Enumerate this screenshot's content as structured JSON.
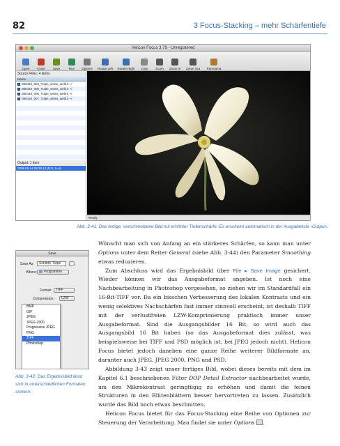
{
  "page": {
    "number": "82",
    "running_head": "3 Focus-Stacking – mehr Schärfentiefe"
  },
  "app": {
    "title": "Helicon Focus 3.79 - Unregistered",
    "toolbar": [
      "Open",
      "Close",
      "Save",
      "Run",
      "Options",
      "Rotate Left",
      "Rotate Right",
      "Copy",
      "Zoom",
      "Zoom in",
      "Zoom Out",
      "Panorama"
    ],
    "source_label": "Source Files: 4 items",
    "col_name": "Name",
    "files": [
      "080419_004_Tulpe_weiss_welk.ti ~/",
      "080419_005_Tulpe_weiss_welk.ti ~/",
      "080419_006_Tulpe_weiss_welk.ti ~/",
      "080419_007_Tulpe_weiss_welk.ti ~/"
    ],
    "output_label": "Output: 1 item",
    "output_row": "2008.05.14 09:25:13 (R:8, S=4)",
    "status": "Ready"
  },
  "caption1": "Abb. 3-41: Das fertige, verschmolzene Bild mit erhöhter Tiefenschärfe. Es erscheint automatisch in der Ausgabeliste ›Output‹.",
  "dialog": {
    "title": "Save",
    "save_as_label": "Save As:",
    "save_as_value": "Schärfe-Tulpe",
    "where_label": "Where:",
    "where_value": "Programme",
    "format_label": "Format:",
    "format_value": "TIFF",
    "compression_label": "Compression:",
    "compression_value": "LZW",
    "formats": [
      "BMP",
      "GIF",
      "JPEG",
      "JPEG-2000",
      "Progressive JPEG",
      "PNG",
      "TIFF",
      "Photoshop"
    ],
    "selected_format": "TIFF"
  },
  "caption2": "Abb. 3-42: Das Ergebnisbild lässt sich in unterschiedlichen Formaten sichern.",
  "body": {
    "p1": {
      "a": "Wünscht man sich von Anfang an ein stärkeres Schärfen, so kann man unter ",
      "b": "Options",
      "c": " unter dem Reiter ",
      "d": "General",
      "e": " (siehe Abb. 3-44) den Parameter ",
      "f": "Smoothing",
      "g": " etwas reduzieren."
    },
    "p2": {
      "a": "Zum Abschluss wird das Ergebnisbild über ",
      "menu": "File ▸ Save Image",
      "b": " gesichert. Wieder können wir das Ausgabeformat angeben. Ist noch eine Nachbearbeitung in Photoshop vorgesehen, so ziehen wir im Standardfall ein 16-Bit-TIFF vor. Da ein bisschen Verbesserung des lokalen Kontrasts und ein wenig selektives Nachschärfen fast immer sinnvoll erscheint, ist deshalb TIFF mit der verlustfreien LZW-Komprimierung praktisch immer unser Ausgabeformat. Sind die Ausgangsbilder 16 Bit, so wird auch das Ausgangsbild 16 Bit haben (so das Ausgabeformat dies zulässt, was beispielsweise bei TIFF und PSD möglich ist, bei JPEG jedoch nicht). Helicon Focus bietet jedoch daneben eine ganze Reihe weiterer Bildformate an, darunter auch JPEG, JPEG 2000, PNG und PSD."
    },
    "p3": {
      "a": "Abbildung 3-43 zeigt unser fertiges Bild, wobei dieses bereits mit dem im Kapitel 6.1 beschriebenen Filter ",
      "b": "DOP Detail Extractor",
      "c": " nachbearbeitet wurde, um den Mikrokontrast geringfügig zu erhöhen und damit die feinen Strukturen in den Blütenblättern besser hervortreten zu lassen. Zusätzlich wurde das Bild noch etwas beschnitten."
    },
    "p4": {
      "a": "Helicon Focus bietet für das Focus-Stacking eine Reihe von Optionen zur Steuerung der Verarbeitung. Man findet sie unter ",
      "b": "Options",
      "c": "."
    }
  },
  "colors": {
    "accent": "#3b6fb0",
    "selection": "#3a72d8"
  }
}
